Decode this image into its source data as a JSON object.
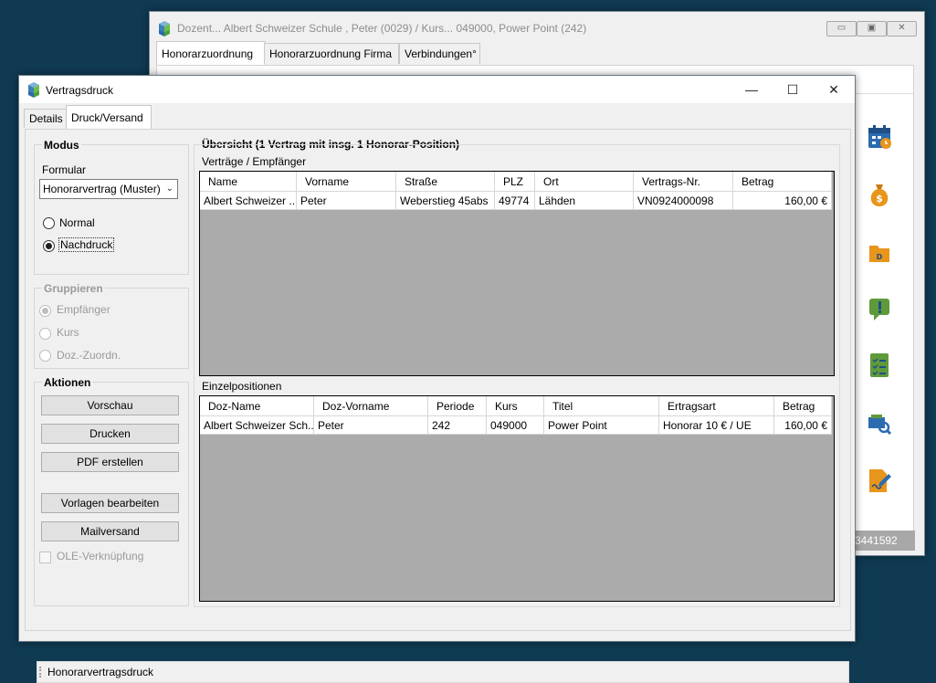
{
  "colors": {
    "desktop": "#0f3a52",
    "grid_bg": "#ababab",
    "accent_orange": "#e8951b",
    "accent_blue": "#2b6cb0",
    "accent_green": "#5e9a3a"
  },
  "back_window": {
    "title": "Dozent... Albert Schweizer Schule , Peter (0029) / Kurs... 049000, Power Point  (242)",
    "tabs": [
      "Honorarzuordnung",
      "Honorarzuordnung Firma",
      "Verbindungen°"
    ],
    "status_text": "3441592",
    "side_icons": [
      "calendar-icon",
      "money-bag-icon",
      "folder-d-icon",
      "alert-message-icon",
      "checklist-icon",
      "search-report-icon",
      "sign-document-icon"
    ]
  },
  "window": {
    "title": "Vertragsdruck",
    "controls": {
      "minimize": "—",
      "maximize": "☐",
      "close": "✕"
    },
    "tabs": [
      "Details",
      "Druck/Versand"
    ],
    "active_tab": "Druck/Versand"
  },
  "modus": {
    "title": "Modus",
    "formular_label": "Formular",
    "formular_value": "Honorarvertrag (Muster)",
    "options": [
      "Normal",
      "Nachdruck"
    ],
    "selected": "Nachdruck"
  },
  "gruppieren": {
    "title": "Gruppieren",
    "options": [
      "Empfänger",
      "Kurs",
      "Doz.-Zuordn."
    ],
    "selected": "Empfänger"
  },
  "aktionen": {
    "title": "Aktionen",
    "buttons": [
      "Vorschau",
      "Drucken",
      "PDF erstellen",
      "Vorlagen bearbeiten",
      "Mailversand"
    ],
    "ole_label": "OLE-Verknüpfung"
  },
  "overview": {
    "title": "Übersicht (1 Vertrag mit insg. 1 Honorar-Position)",
    "contracts_label": "Verträge / Empfänger",
    "contracts_columns": [
      "Name",
      "Vorname",
      "Straße",
      "PLZ",
      "Ort",
      "Vertrags-Nr.",
      "Betrag"
    ],
    "contracts_rows": [
      [
        "Albert Schweizer ...",
        "Peter",
        "Weberstieg 45abs",
        "49774",
        "Lähden",
        "VN0924000098",
        "160,00 €"
      ]
    ],
    "positions_label": "Einzelpositionen",
    "positions_columns": [
      "Doz-Name",
      "Doz-Vorname",
      "Periode",
      "Kurs",
      "Titel",
      "Ertragsart",
      "Betrag"
    ],
    "positions_rows": [
      [
        "Albert Schweizer Sch...",
        "Peter",
        "242",
        "049000",
        "Power Point",
        "Honorar 10 € / UE",
        "160,00 €"
      ]
    ]
  },
  "status_bar": {
    "text": "Honorarvertragsdruck"
  }
}
